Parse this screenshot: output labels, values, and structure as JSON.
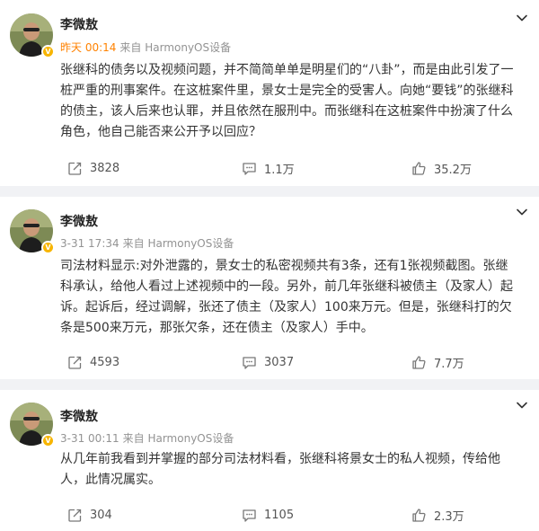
{
  "posts": [
    {
      "author": "李微敖",
      "time": "昨天 00:14",
      "source": "来自 HarmonyOS设备",
      "time_highlight": true,
      "text": "张继科的债务以及视频问题，并不简简单单是明星们的“八卦”，而是由此引发了一桩严重的刑事案件。在这桩案件里，景女士是完全的受害人。向她“要钱”的张继科的债主，该人后来也认罪，并且依然在服刑中。而张继科在这桩案件中扮演了什么角色，他自己能否来公开予以回应？",
      "reposts": "3828",
      "comments": "1.1万",
      "likes": "35.2万"
    },
    {
      "author": "李微敖",
      "time": "3-31 17:34",
      "source": "来自 HarmonyOS设备",
      "time_highlight": false,
      "text": "司法材料显示:对外泄露的，景女士的私密视频共有3条，还有1张视频截图。张继科承认，给他人看过上述视频中的一段。另外，前几年张继科被债主（及家人）起诉。起诉后，经过调解，张还了债主（及家人）100来万元。但是，张继科打的欠条是500来万元，那张欠条，还在债主（及家人）手中。",
      "reposts": "4593",
      "comments": "3037",
      "likes": "7.7万"
    },
    {
      "author": "李微敖",
      "time": "3-31 00:11",
      "source": "来自 HarmonyOS设备",
      "time_highlight": false,
      "text": "从几年前我看到并掌握的部分司法材料看，张继科将景女士的私人视频，传给他人，此情况属实。",
      "reposts": "304",
      "comments": "1105",
      "likes": "2.3万"
    }
  ],
  "icons": {
    "repost": "repost-icon",
    "comment": "comment-icon",
    "like": "like-icon",
    "menu": "chevron-down-icon",
    "verified": "verified-badge-icon"
  },
  "colors": {
    "accent_time": "#ff8200",
    "meta": "#939393",
    "divider": "#f1f2f5",
    "badge": "#f7b500"
  }
}
